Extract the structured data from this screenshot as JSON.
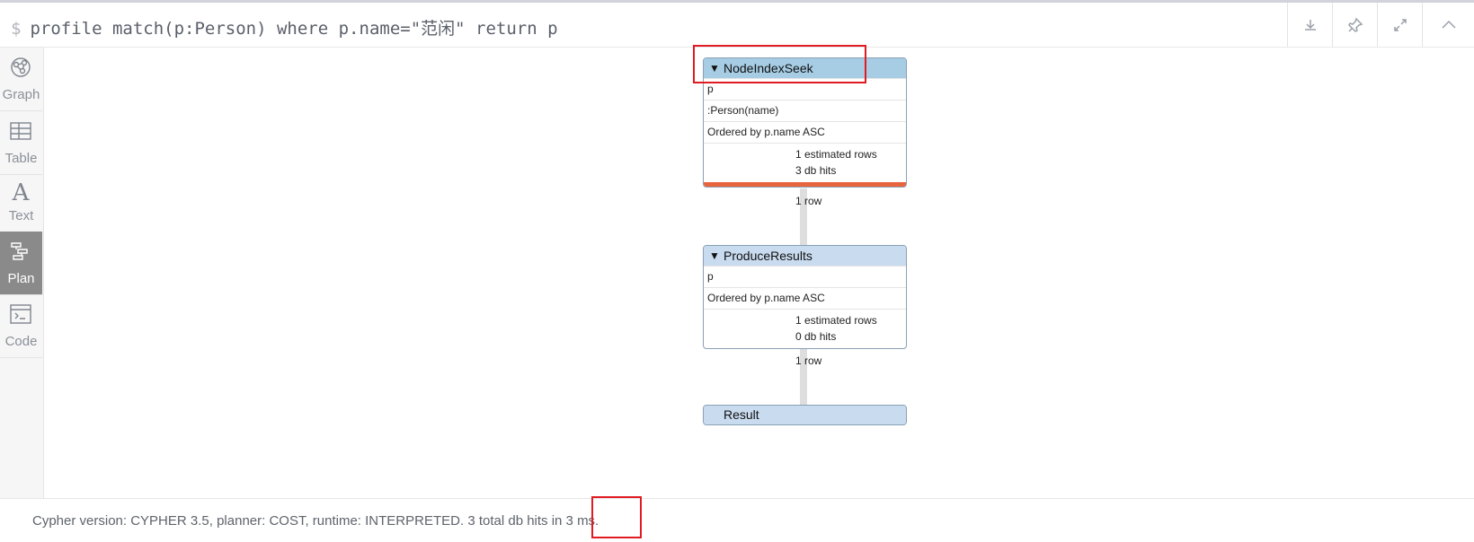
{
  "query": {
    "prompt": "$",
    "text": "profile match(p:Person) where p.name=\"范闲\" return p"
  },
  "toolbar": {
    "download_icon": "download-icon",
    "pin_icon": "pin-icon",
    "expand_icon": "expand-icon",
    "collapse_icon": "chevron-up-icon"
  },
  "sidebar": {
    "items": [
      {
        "label": "Graph",
        "icon": "graph-icon"
      },
      {
        "label": "Table",
        "icon": "table-icon"
      },
      {
        "label": "Text",
        "icon": "text-icon",
        "glyph": "A"
      },
      {
        "label": "Plan",
        "icon": "plan-icon",
        "active": true
      },
      {
        "label": "Code",
        "icon": "code-icon"
      }
    ]
  },
  "plan": {
    "operators": [
      {
        "name": "NodeIndexSeek",
        "rows": [
          "p",
          ":Person(name)",
          "Ordered by p.name ASC"
        ],
        "estimated_rows": "1 estimated rows",
        "db_hits": "3 db hits",
        "header_color": "#a6cde4"
      },
      {
        "name": "ProduceResults",
        "rows": [
          "p",
          "Ordered by p.name ASC"
        ],
        "estimated_rows": "1 estimated rows",
        "db_hits": "0 db hits",
        "header_color": "#c9dbef"
      },
      {
        "name": "Result",
        "header_color": "#c9dbef"
      }
    ],
    "edges": [
      "1 row",
      "1 row"
    ],
    "triangle": "▼"
  },
  "footer": {
    "text": "Cypher version: CYPHER 3.5, planner: COST, runtime: INTERPRETED. 3 total db hits in 3 ms."
  },
  "colors": {
    "highlight_box": "#e01b22",
    "hits_bar": "#e8643d",
    "active_tab": "#8a8a8a"
  }
}
